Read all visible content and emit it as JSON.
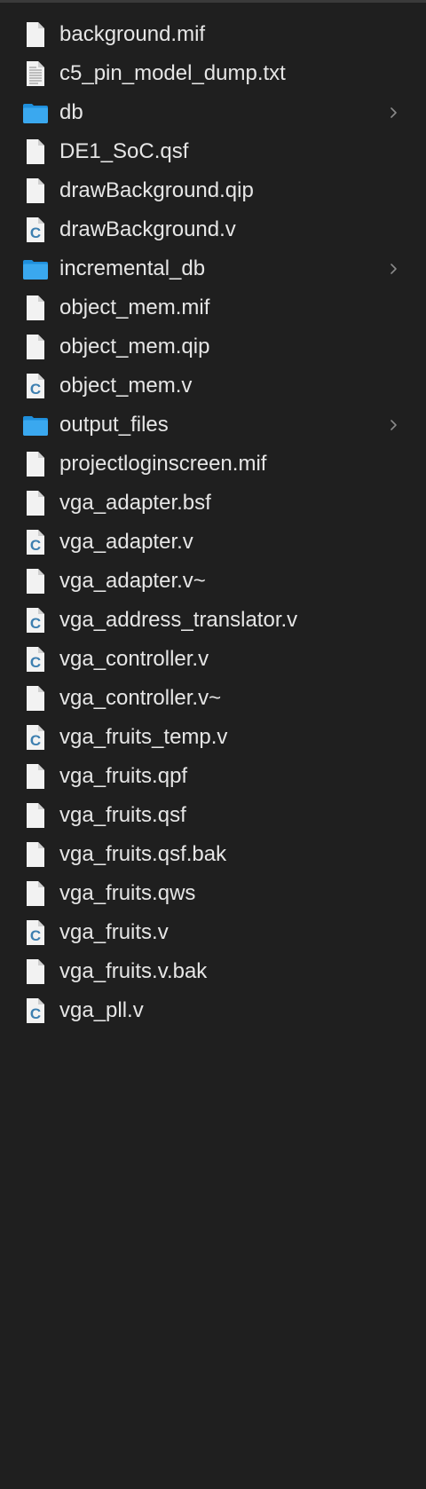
{
  "files": [
    {
      "name": "background.mif",
      "type": "doc"
    },
    {
      "name": "c5_pin_model_dump.txt",
      "type": "text"
    },
    {
      "name": "db",
      "type": "folder"
    },
    {
      "name": "DE1_SoC.qsf",
      "type": "doc"
    },
    {
      "name": "drawBackground.qip",
      "type": "doc"
    },
    {
      "name": "drawBackground.v",
      "type": "c"
    },
    {
      "name": "incremental_db",
      "type": "folder"
    },
    {
      "name": "object_mem.mif",
      "type": "doc"
    },
    {
      "name": "object_mem.qip",
      "type": "doc"
    },
    {
      "name": "object_mem.v",
      "type": "c"
    },
    {
      "name": "output_files",
      "type": "folder"
    },
    {
      "name": "projectloginscreen.mif",
      "type": "doc"
    },
    {
      "name": "vga_adapter.bsf",
      "type": "doc"
    },
    {
      "name": "vga_adapter.v",
      "type": "c"
    },
    {
      "name": "vga_adapter.v~",
      "type": "doc"
    },
    {
      "name": "vga_address_translator.v",
      "type": "c"
    },
    {
      "name": "vga_controller.v",
      "type": "c"
    },
    {
      "name": "vga_controller.v~",
      "type": "doc"
    },
    {
      "name": "vga_fruits_temp.v",
      "type": "c"
    },
    {
      "name": "vga_fruits.qpf",
      "type": "doc"
    },
    {
      "name": "vga_fruits.qsf",
      "type": "doc"
    },
    {
      "name": "vga_fruits.qsf.bak",
      "type": "doc"
    },
    {
      "name": "vga_fruits.qws",
      "type": "doc"
    },
    {
      "name": "vga_fruits.v",
      "type": "c"
    },
    {
      "name": "vga_fruits.v.bak",
      "type": "doc"
    },
    {
      "name": "vga_pll.v",
      "type": "c"
    }
  ],
  "colors": {
    "background": "#1f1f1f",
    "text": "#e6e6e6",
    "folder": "#3aa8ef",
    "c_letter": "#3d7fb0",
    "chevron": "#8a8a8a"
  }
}
